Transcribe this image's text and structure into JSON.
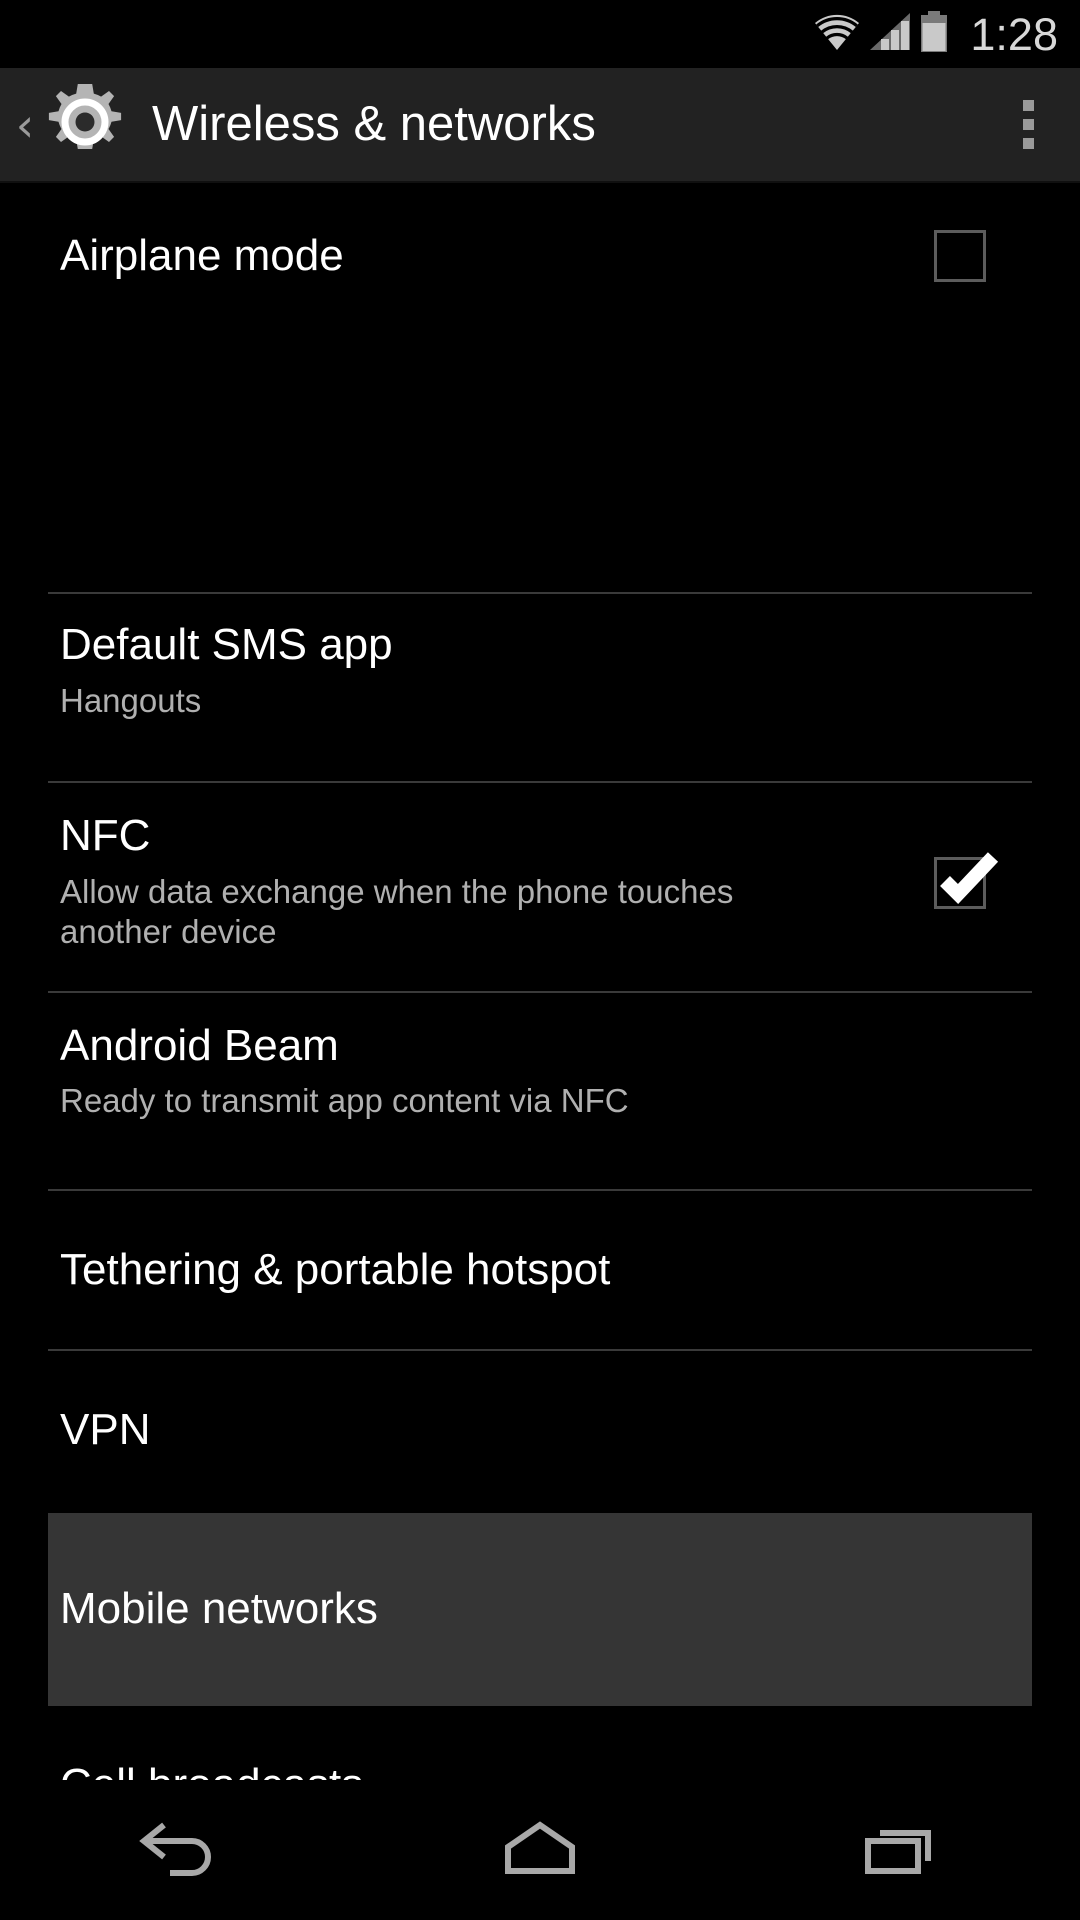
{
  "status_bar": {
    "time": "1:28",
    "icons": [
      "wifi-icon",
      "cellular-signal-icon",
      "battery-icon"
    ]
  },
  "action_bar": {
    "back_label": "‹",
    "app_icon": "settings-gear-icon",
    "title": "Wireless & networks",
    "overflow_label": "overflow-menu-icon"
  },
  "settings": {
    "items": [
      {
        "title": "Airplane mode",
        "summary": "",
        "widget": "checkbox",
        "checked": false,
        "highlighted": false
      },
      {
        "title": "Default SMS app",
        "summary": "Hangouts",
        "widget": "none",
        "checked": null,
        "highlighted": false
      },
      {
        "title": "NFC",
        "summary": "Allow data exchange when the phone touches another device",
        "widget": "checkbox",
        "checked": true,
        "highlighted": false
      },
      {
        "title": "Android Beam",
        "summary": "Ready to transmit app content via NFC",
        "widget": "none",
        "checked": null,
        "highlighted": false
      },
      {
        "title": "Tethering & portable hotspot",
        "summary": "",
        "widget": "none",
        "checked": null,
        "highlighted": false
      },
      {
        "title": "VPN",
        "summary": "",
        "widget": "none",
        "checked": null,
        "highlighted": false
      },
      {
        "title": "Mobile networks",
        "summary": "",
        "widget": "none",
        "checked": null,
        "highlighted": true
      },
      {
        "title": "Cell broadcasts",
        "summary": "",
        "widget": "none",
        "checked": null,
        "highlighted": false
      }
    ]
  },
  "nav_bar": {
    "back": "back-icon",
    "home": "home-icon",
    "recents": "recents-icon"
  },
  "colors": {
    "window_background": "#000000",
    "action_bar_background": "#222222",
    "highlight_row_background": "#353535",
    "primary_text": "#ffffff",
    "secondary_text": "#b0b0b0",
    "divider": "#3a3a3a",
    "icon_gray": "#9a9a9a"
  }
}
